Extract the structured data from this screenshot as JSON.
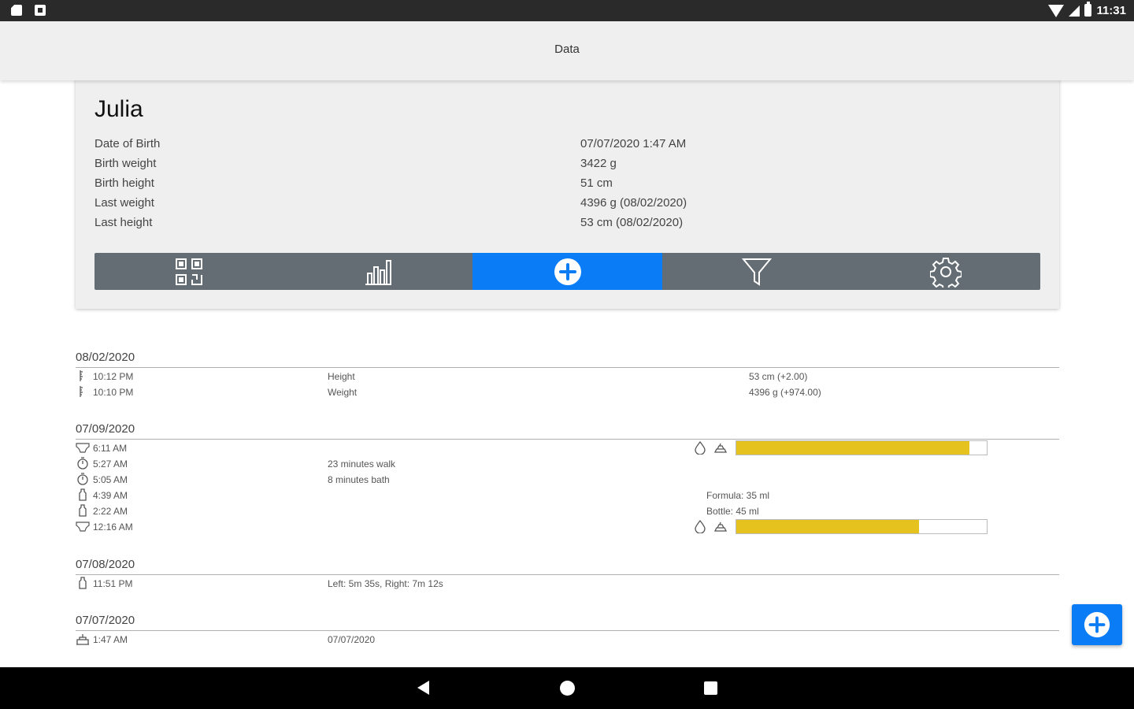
{
  "status_bar": {
    "time": "11:31"
  },
  "app_bar": {
    "title": "Data"
  },
  "profile": {
    "name": "Julia",
    "rows": [
      {
        "label": "Date of Birth",
        "value": "07/07/2020 1:47 AM"
      },
      {
        "label": "Birth weight",
        "value": "3422 g"
      },
      {
        "label": "Birth height",
        "value": "51 cm"
      },
      {
        "label": "Last weight",
        "value": "4396 g (08/02/2020)"
      },
      {
        "label": "Last height",
        "value": "53 cm (08/02/2020)"
      }
    ]
  },
  "toolbar": {
    "items": [
      "qr-icon",
      "bar-chart-icon",
      "add-circle-icon",
      "filter-icon",
      "settings-icon"
    ],
    "active_index": 2,
    "active_color": "#0a7cf5",
    "background": "#646d73"
  },
  "timeline": [
    {
      "date": "08/02/2020",
      "entries": [
        {
          "icon": "ruler-icon",
          "time": "10:12 PM",
          "desc": "Height",
          "value": "53 cm (+2.00)"
        },
        {
          "icon": "ruler-icon",
          "time": "10:10 PM",
          "desc": "Weight",
          "value": "4396 g (+974.00)"
        }
      ]
    },
    {
      "date": "07/09/2020",
      "entries": [
        {
          "icon": "diaper-icon",
          "time": "6:11 AM",
          "bar_fill": 0.93
        },
        {
          "icon": "timer-icon",
          "time": "5:27 AM",
          "desc": "23 minutes walk"
        },
        {
          "icon": "timer-icon",
          "time": "5:05 AM",
          "desc": "8 minutes bath"
        },
        {
          "icon": "bottle-icon",
          "time": "4:39 AM",
          "note": "Formula: 35 ml"
        },
        {
          "icon": "bottle-icon",
          "time": "2:22 AM",
          "note": "Bottle: 45 ml"
        },
        {
          "icon": "diaper-icon",
          "time": "12:16 AM",
          "bar_fill": 0.73
        }
      ]
    },
    {
      "date": "07/08/2020",
      "entries": [
        {
          "icon": "bottle-icon",
          "time": "11:51 PM",
          "desc": "Left: 5m 35s, Right: 7m 12s"
        }
      ]
    },
    {
      "date": "07/07/2020",
      "entries": [
        {
          "icon": "cake-icon",
          "time": "1:47 AM",
          "desc": "07/07/2020"
        }
      ]
    }
  ],
  "bar_color": "#e6c21e"
}
